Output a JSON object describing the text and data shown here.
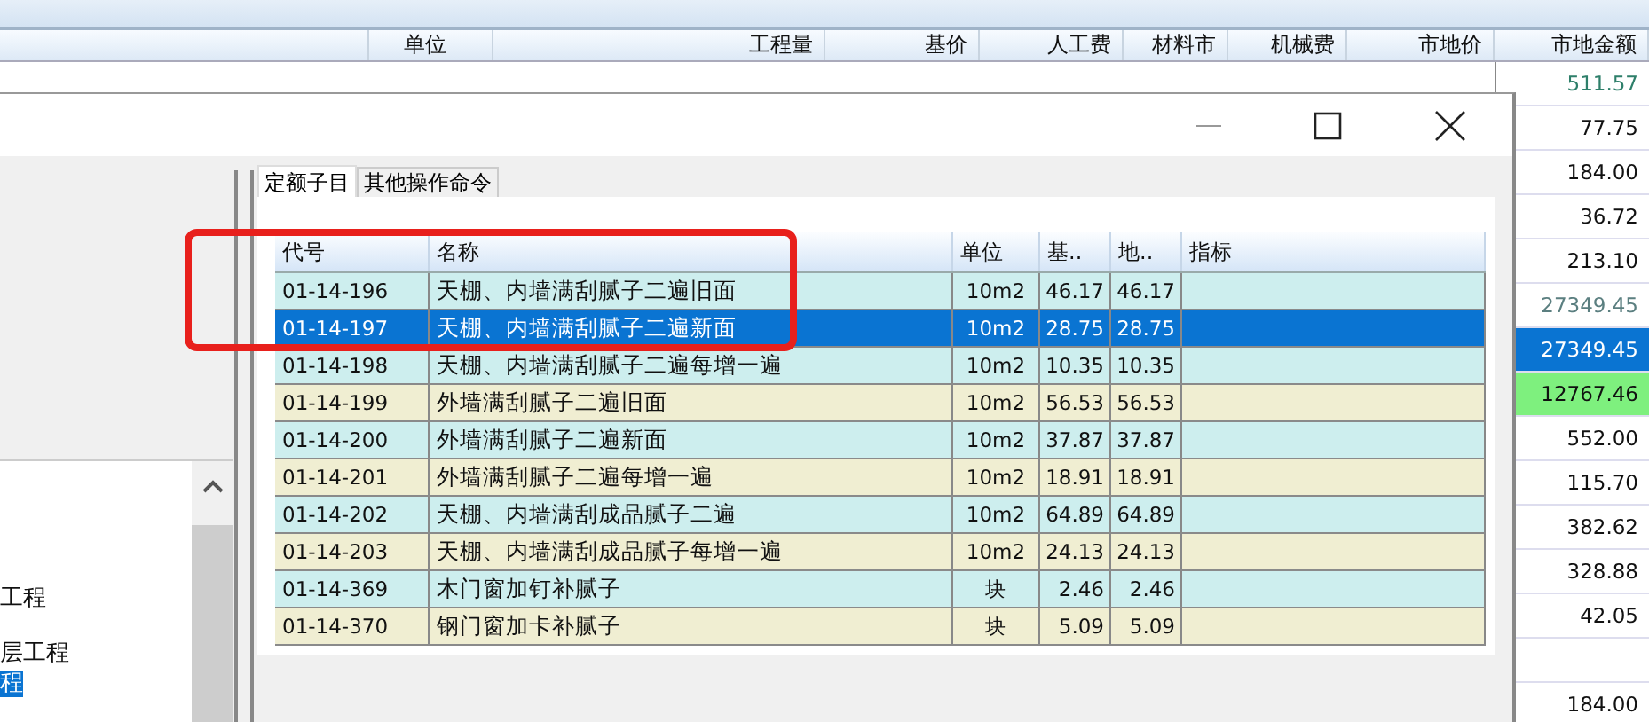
{
  "sheet": {
    "columns": [
      "单位",
      "工程量",
      "基价",
      "人工费",
      "材料市",
      "机械费",
      "市地价",
      "市地金额"
    ],
    "amounts": [
      {
        "value": "511.57",
        "kind": "teal"
      },
      {
        "value": "77.75",
        "kind": "plain"
      },
      {
        "value": "184.00",
        "kind": "plain"
      },
      {
        "value": "36.72",
        "kind": "plain"
      },
      {
        "value": "213.10",
        "kind": "plain"
      },
      {
        "value": "27349.45",
        "kind": "muted"
      },
      {
        "value": "27349.45",
        "kind": "selected"
      },
      {
        "value": "12767.46",
        "kind": "highlight"
      },
      {
        "value": "552.00",
        "kind": "plain"
      },
      {
        "value": "115.70",
        "kind": "plain"
      },
      {
        "value": "382.62",
        "kind": "plain"
      },
      {
        "value": "328.88",
        "kind": "plain"
      },
      {
        "value": "42.05",
        "kind": "plain"
      },
      {
        "kind": "empty"
      },
      {
        "value": "184.00",
        "kind": "plain"
      }
    ]
  },
  "dialog": {
    "tree_items": [
      {
        "label": "工程",
        "selected": false
      },
      {
        "label": "层工程",
        "selected": false
      },
      {
        "label": "程",
        "selected": true
      }
    ],
    "tabs": [
      {
        "label": "定额子目",
        "selected": true
      },
      {
        "label": "其他操作命令",
        "selected": false
      }
    ],
    "grid": {
      "columns": [
        "代号",
        "名称",
        "单位",
        "基..",
        "地..",
        "指标"
      ],
      "rows": [
        {
          "code": "01-14-196",
          "name": "天棚、内墙满刮腻子二遍旧面",
          "unit": "10m2",
          "base": "46.17",
          "local": "46.17",
          "selected": false
        },
        {
          "code": "01-14-197",
          "name": "天棚、内墙满刮腻子二遍新面",
          "unit": "10m2",
          "base": "28.75",
          "local": "28.75",
          "selected": true
        },
        {
          "code": "01-14-198",
          "name": "天棚、内墙满刮腻子二遍每增一遍",
          "unit": "10m2",
          "base": "10.35",
          "local": "10.35",
          "selected": false
        },
        {
          "code": "01-14-199",
          "name": "外墙满刮腻子二遍旧面",
          "unit": "10m2",
          "base": "56.53",
          "local": "56.53",
          "selected": false
        },
        {
          "code": "01-14-200",
          "name": "外墙满刮腻子二遍新面",
          "unit": "10m2",
          "base": "37.87",
          "local": "37.87",
          "selected": false
        },
        {
          "code": "01-14-201",
          "name": "外墙满刮腻子二遍每增一遍",
          "unit": "10m2",
          "base": "18.91",
          "local": "18.91",
          "selected": false
        },
        {
          "code": "01-14-202",
          "name": "天棚、内墙满刮成品腻子二遍",
          "unit": "10m2",
          "base": "64.89",
          "local": "64.89",
          "selected": false
        },
        {
          "code": "01-14-203",
          "name": "天棚、内墙满刮成品腻子每增一遍",
          "unit": "10m2",
          "base": "24.13",
          "local": "24.13",
          "selected": false
        },
        {
          "code": "01-14-369",
          "name": "木门窗加钉补腻子",
          "unit": "块",
          "base": "2.46",
          "local": "2.46",
          "selected": false
        },
        {
          "code": "01-14-370",
          "name": "钢门窗加卡补腻子",
          "unit": "块",
          "base": "5.09",
          "local": "5.09",
          "selected": false
        }
      ]
    }
  }
}
